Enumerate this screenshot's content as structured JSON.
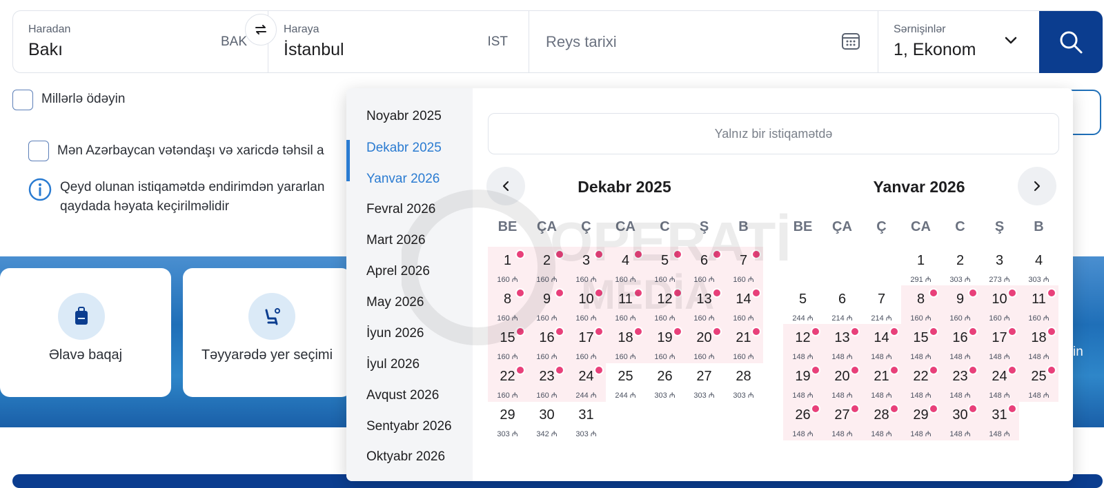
{
  "search": {
    "from_label": "Haradan",
    "from_value": "Bakı",
    "from_code": "BAK",
    "to_label": "Haraya",
    "to_value": "İstanbul",
    "to_code": "IST",
    "date_placeholder": "Reys tarixi",
    "pax_label": "Sərnişinlər",
    "pax_value": "1, Ekonom",
    "swap_icon": "swap-arrows-icon",
    "search_icon": "search-icon"
  },
  "options": {
    "miles_label": "Millərlə ödəyin",
    "student_label": "Mən Azərbaycan vətəndaşı və xaricdə təhsil a",
    "note_line1": "Qeyd olunan istiqamətdə endirimdən yararlan",
    "note_line2": "qaydada həyata keçirilməlidir"
  },
  "services": [
    {
      "label": "Əlavə baqaj",
      "icon": "luggage-icon"
    },
    {
      "label": "Təyyarədə yer seçimi",
      "icon": "seat-icon"
    }
  ],
  "services_partial_text": "in",
  "calendar": {
    "month_list": [
      "Noyabr 2025",
      "Dekabr 2025",
      "Yanvar 2026",
      "Fevral 2026",
      "Mart 2026",
      "Aprel 2026",
      "May 2026",
      "İyun 2026",
      "İyul 2026",
      "Avqust 2026",
      "Sentyabr 2026",
      "Oktyabr 2026"
    ],
    "selected_month": "Dekabr 2025",
    "one_way_label": "Yalnız bir istiqamətdə",
    "weekdays": [
      "BE",
      "ÇA",
      "Ç",
      "CA",
      "C",
      "Ş",
      "B"
    ],
    "currency": "₼",
    "left": {
      "title": "Dekabr 2025",
      "offset": 0,
      "days": [
        [
          1,
          160,
          true
        ],
        [
          2,
          160,
          true
        ],
        [
          3,
          160,
          true
        ],
        [
          4,
          160,
          true
        ],
        [
          5,
          160,
          true
        ],
        [
          6,
          160,
          true
        ],
        [
          7,
          160,
          true
        ],
        [
          8,
          160,
          true
        ],
        [
          9,
          160,
          true
        ],
        [
          10,
          160,
          true
        ],
        [
          11,
          160,
          true
        ],
        [
          12,
          160,
          true
        ],
        [
          13,
          160,
          true
        ],
        [
          14,
          160,
          true
        ],
        [
          15,
          160,
          true
        ],
        [
          16,
          160,
          true
        ],
        [
          17,
          160,
          true
        ],
        [
          18,
          160,
          true
        ],
        [
          19,
          160,
          true
        ],
        [
          20,
          160,
          true
        ],
        [
          21,
          160,
          true
        ],
        [
          22,
          160,
          true
        ],
        [
          23,
          160,
          true
        ],
        [
          24,
          244,
          true
        ],
        [
          25,
          244,
          false
        ],
        [
          26,
          303,
          false
        ],
        [
          27,
          303,
          false
        ],
        [
          28,
          303,
          false
        ],
        [
          29,
          303,
          false
        ],
        [
          30,
          342,
          false
        ],
        [
          31,
          303,
          false
        ]
      ]
    },
    "right": {
      "title": "Yanvar 2026",
      "offset": 3,
      "days": [
        [
          1,
          291,
          false
        ],
        [
          2,
          303,
          false
        ],
        [
          3,
          273,
          false
        ],
        [
          4,
          303,
          false
        ],
        [
          5,
          244,
          false
        ],
        [
          6,
          214,
          false
        ],
        [
          7,
          214,
          false
        ],
        [
          8,
          160,
          true
        ],
        [
          9,
          160,
          true
        ],
        [
          10,
          160,
          true
        ],
        [
          11,
          160,
          true
        ],
        [
          12,
          148,
          true
        ],
        [
          13,
          148,
          true
        ],
        [
          14,
          148,
          true
        ],
        [
          15,
          148,
          true
        ],
        [
          16,
          148,
          true
        ],
        [
          17,
          148,
          true
        ],
        [
          18,
          148,
          true
        ],
        [
          19,
          148,
          true
        ],
        [
          20,
          148,
          true
        ],
        [
          21,
          148,
          true
        ],
        [
          22,
          148,
          true
        ],
        [
          23,
          148,
          true
        ],
        [
          24,
          148,
          true
        ],
        [
          25,
          148,
          true
        ],
        [
          26,
          148,
          true
        ],
        [
          27,
          148,
          true
        ],
        [
          28,
          148,
          true
        ],
        [
          29,
          148,
          true
        ],
        [
          30,
          148,
          true
        ],
        [
          31,
          148,
          true
        ]
      ]
    }
  },
  "watermark": {
    "line1": "OPERATİV",
    "line2": "MEDİA"
  },
  "colors": {
    "primary": "#0b3d8f",
    "accent": "#2a7bd1",
    "discount_dot": "#e8407a",
    "discount_bg": "#fdeef1"
  }
}
